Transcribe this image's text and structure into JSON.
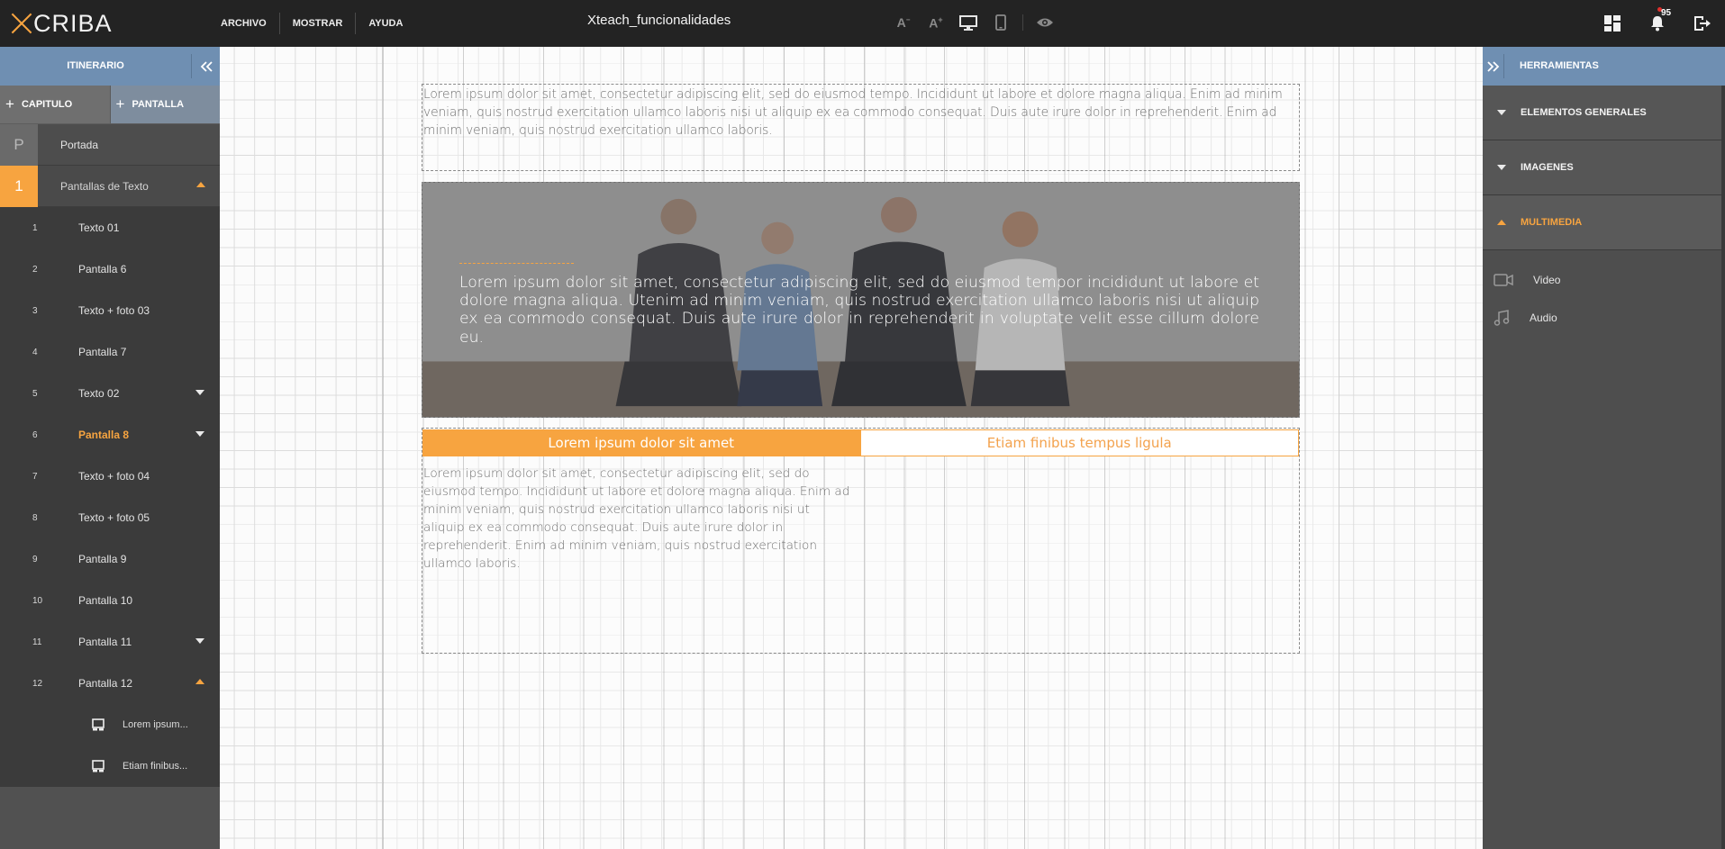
{
  "app": {
    "logo_text": "CRIBA",
    "doc_title": "Xteach_funcionalidades",
    "accent_color": "#f7a440",
    "header_blue": "#6f8fb2"
  },
  "menu": [
    "ARCHIVO",
    "MOSTRAR",
    "AYUDA"
  ],
  "view_tools": {
    "font_decrease": "A",
    "font_increase": "A"
  },
  "notifications": {
    "count": "95"
  },
  "left_panel": {
    "title": "ITINERARIO",
    "add_chapter": "CAPITULO",
    "add_screen": "PANTALLA",
    "portada": {
      "badge": "P",
      "label": "Portada"
    },
    "chapter": {
      "badge": "1",
      "label": "Pantallas de Texto"
    },
    "screens": [
      {
        "num": "1",
        "label": "Texto 01"
      },
      {
        "num": "2",
        "label": "Pantalla 6"
      },
      {
        "num": "3",
        "label": "Texto + foto 03"
      },
      {
        "num": "4",
        "label": "Pantalla 7"
      },
      {
        "num": "5",
        "label": "Texto 02"
      },
      {
        "num": "6",
        "label": "Pantalla 8"
      },
      {
        "num": "7",
        "label": "Texto + foto 04"
      },
      {
        "num": "8",
        "label": "Texto + foto 05"
      },
      {
        "num": "9",
        "label": "Pantalla 9"
      },
      {
        "num": "10",
        "label": "Pantalla 10"
      },
      {
        "num": "11",
        "label": "Pantalla 11"
      },
      {
        "num": "12",
        "label": "Pantalla 12"
      }
    ],
    "sub_items": [
      "Lorem ipsum...",
      "Etiam finibus..."
    ]
  },
  "canvas": {
    "block1_text": "Lorem ipsum dolor sit amet, consectetur adipiscing elit, sed do eiusmod tempo. Incididunt ut labore et dolore magna aliqua. Enim ad minim veniam, quis nostrud exercitation ullamco laboris nisi ut aliquip ex ea commodo consequat. Duis aute irure dolor in reprehenderit. Enim ad minim veniam, quis nostrud exercitation ullamco laboris.",
    "hero_text": "Lorem ipsum dolor sit amet, consectetur adipiscing elit, sed do eiusmod tempor incididunt ut labore et dolore magna aliqua. Utenim ad minim veniam, quis nostrud exercitation ullamco laboris nisi ut aliquip ex ea commodo consequat. Duis aute irure dolor in reprehenderit in voluptate velit esse cillum dolore eu.",
    "tab_active": "Lorem ipsum dolor sit amet",
    "tab_inactive": "Etiam finibus tempus ligula",
    "tab_body": "Lorem ipsum dolor sit amet, consectetur adipiscing elit, sed do eiusmod tempo. Incididunt ut labore et dolore magna aliqua. Enim ad minim veniam, quis nostrud exercitation ullamco laboris nisi ut aliquip ex ea commodo consequat. Duis aute irure dolor in reprehenderit. Enim ad minim veniam, quis nostrud exercitation ullamco laboris."
  },
  "right_panel": {
    "title": "HERRAMIENTAS",
    "sections": [
      "ELEMENTOS GENERALES",
      "IMAGENES",
      "MULTIMEDIA"
    ],
    "tools": [
      "Video",
      "Audio"
    ]
  }
}
